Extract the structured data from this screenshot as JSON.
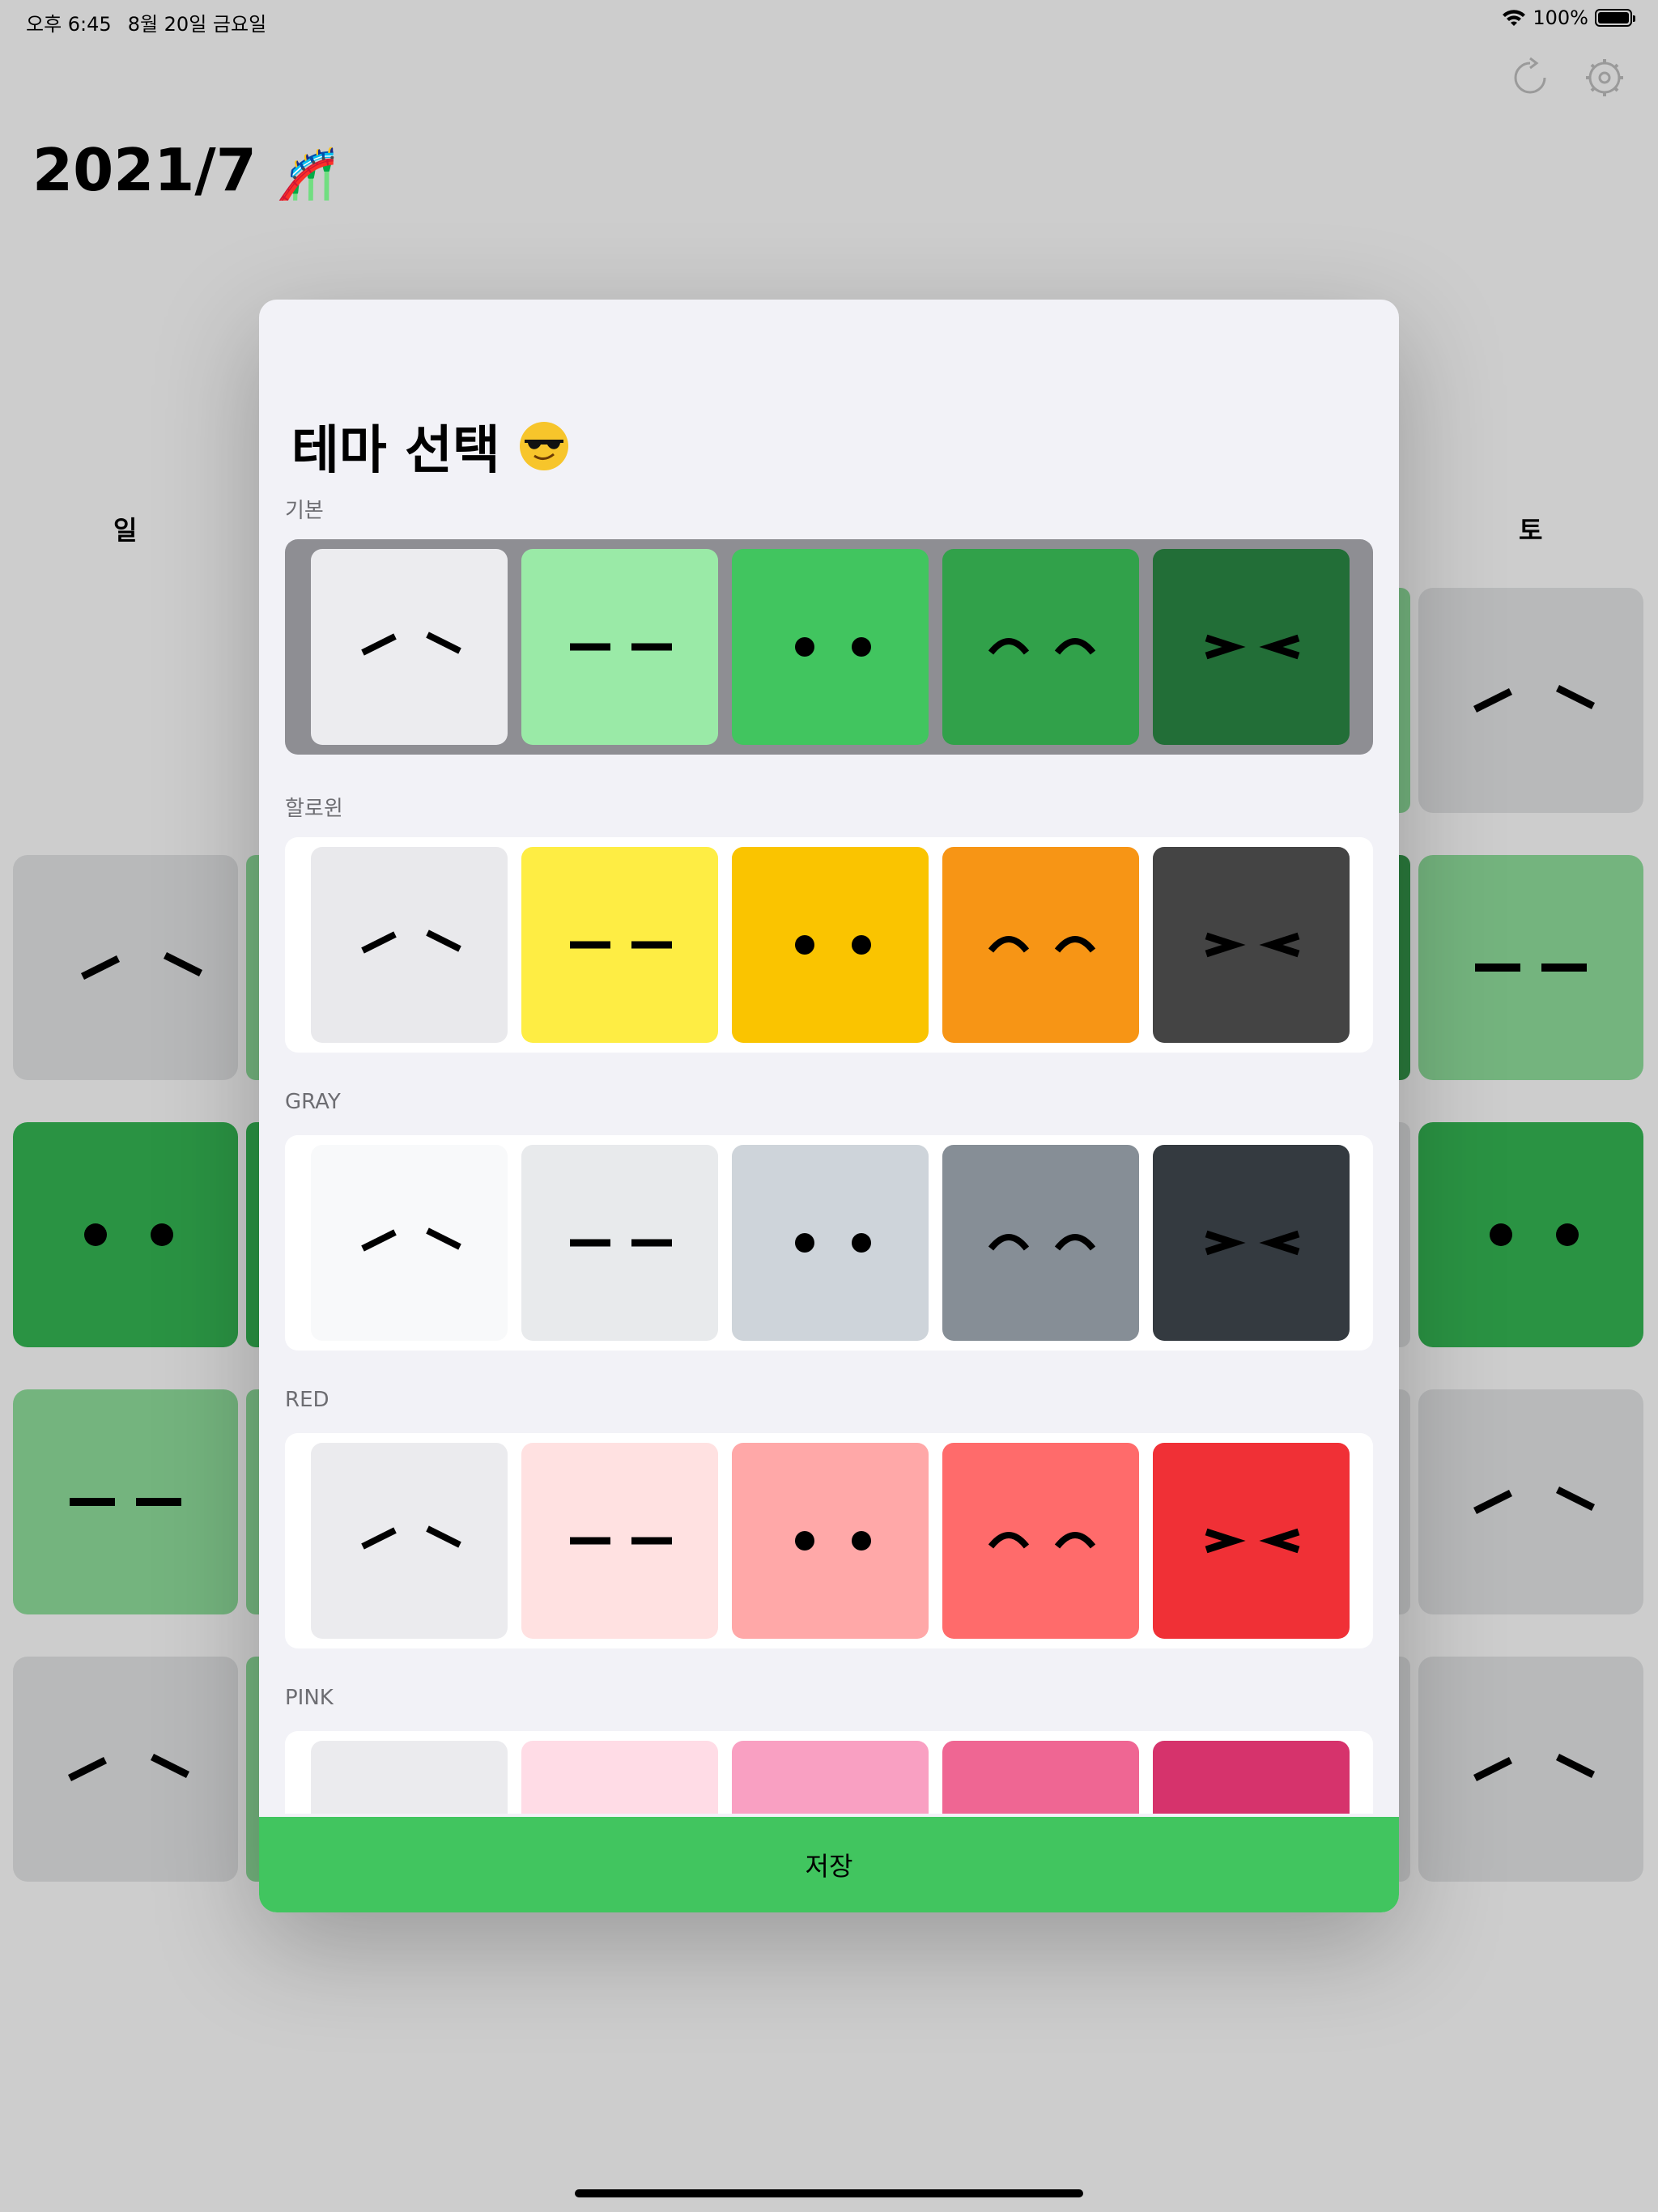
{
  "status_bar": {
    "time": "오후 6:45",
    "date": "8월 20일 금요일",
    "battery": "100%",
    "battery_fraction": 1.0
  },
  "header": {
    "month": "2021/7",
    "month_emoji": "🎢"
  },
  "weekdays": {
    "sun": "일",
    "sat": "토"
  },
  "modal": {
    "title": "테마 선택",
    "title_icon": "sunglasses-emoji-icon",
    "save_label": "저장",
    "sections": [
      {
        "label": "기본",
        "selected": true,
        "colors": [
          "#ececef",
          "#9aeaa7",
          "#41c55f",
          "#31a14a",
          "#226e37"
        ]
      },
      {
        "label": "할로윈",
        "selected": false,
        "colors": [
          "#e9e9ec",
          "#feed44",
          "#fac400",
          "#f79515",
          "#444444"
        ]
      },
      {
        "label": "GRAY",
        "selected": false,
        "colors": [
          "#f8f9fa",
          "#e8eaec",
          "#ced4da",
          "#868e96",
          "#343a40"
        ]
      },
      {
        "label": "RED",
        "selected": false,
        "colors": [
          "#ebebee",
          "#ffe1e1",
          "#ffa8a8",
          "#ff6b6b",
          "#f03036"
        ]
      },
      {
        "label": "PINK",
        "selected": false,
        "colors": [
          "#ebebee",
          "#ffdce6",
          "#f9a0c2",
          "#ef6693",
          "#d6336c"
        ]
      }
    ],
    "faces": [
      "slash-eyes-icon",
      "dash-eyes-icon",
      "dot-eyes-icon",
      "arch-eyes-icon",
      "squint-eyes-icon"
    ]
  },
  "icons": {
    "refresh": "refresh-icon",
    "settings": "settings-icon"
  }
}
